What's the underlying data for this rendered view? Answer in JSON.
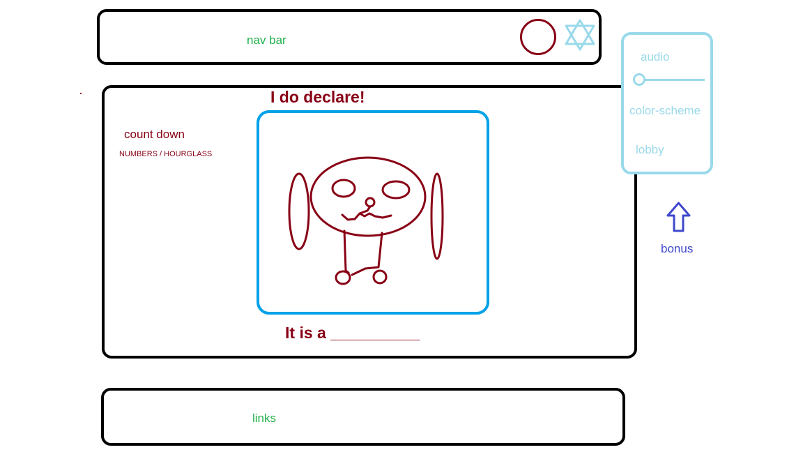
{
  "nav": {
    "label": "nav bar",
    "profile_icon": "profile-circle-icon",
    "favorite_icon": "star-icon"
  },
  "main": {
    "title": "I do declare!",
    "countdown_label": "count down",
    "countdown_sub": "NUMBERS / HOURGLASS",
    "guess_prompt": "It is a __________"
  },
  "settings": {
    "audio_label": "audio",
    "audio_level": 0,
    "color_scheme_label": "color-scheme",
    "lobby_label": "lobby"
  },
  "bonus": {
    "label": "bonus",
    "icon": "arrow-up-icon"
  },
  "footer": {
    "links_label": "links"
  },
  "colors": {
    "frame": "#000000",
    "nav_text": "#22b14c",
    "accent_red": "#880015",
    "drawing_frame": "#00a2e8",
    "settings": "#99d9ea",
    "bonus": "#3f48cc"
  }
}
